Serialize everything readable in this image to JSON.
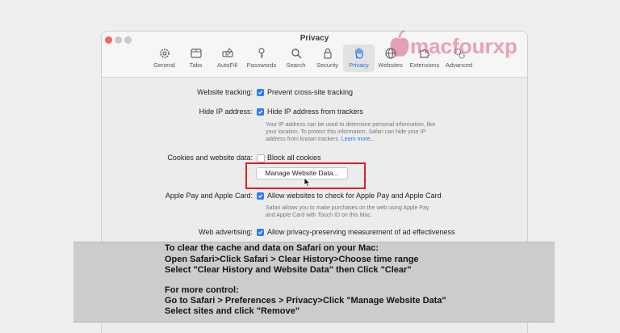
{
  "window": {
    "title": "Privacy"
  },
  "toolbar": {
    "items": [
      {
        "label": "General",
        "icon": "gear-icon"
      },
      {
        "label": "Tabs",
        "icon": "tabs-icon"
      },
      {
        "label": "AutoFill",
        "icon": "autofill-icon"
      },
      {
        "label": "Passwords",
        "icon": "key-icon"
      },
      {
        "label": "Search",
        "icon": "search-icon"
      },
      {
        "label": "Security",
        "icon": "lock-icon"
      },
      {
        "label": "Privacy",
        "icon": "hand-icon",
        "active": true
      },
      {
        "label": "Websites",
        "icon": "globe-icon"
      },
      {
        "label": "Extensions",
        "icon": "puzzle-icon"
      },
      {
        "label": "Advanced",
        "icon": "advanced-gears-icon"
      }
    ]
  },
  "settings": {
    "website_tracking": {
      "label": "Website tracking:",
      "option": "Prevent cross-site tracking",
      "checked": true
    },
    "hide_ip": {
      "label": "Hide IP address:",
      "option": "Hide IP address from trackers",
      "checked": true,
      "desc1": "Your IP address can be used to determine personal information, like",
      "desc2": "your location. To protect this information, Safari can hide your IP",
      "desc3": "address from known trackers.",
      "link": "Learn more..."
    },
    "cookies": {
      "label": "Cookies and website data:",
      "option": "Block all cookies",
      "checked": false,
      "button": "Manage Website Data..."
    },
    "apple_pay": {
      "label": "Apple Pay and Apple Card:",
      "option": "Allow websites to check for Apple Pay and Apple Card",
      "checked": true,
      "desc1": "Safari allows you to make purchases on the web using Apple Pay",
      "desc2": "and Apple Card with Touch ID on this Mac."
    },
    "web_advertising": {
      "label": "Web advertising:",
      "option": "Allow privacy-preserving measurement of ad effectiveness",
      "checked": true
    }
  },
  "watermark": {
    "text": "macfourxp"
  },
  "instructions": {
    "line1": "To clear the cache and data on Safari on your Mac:",
    "line2": "Open Safari>Click Safari > Clear History>Choose time range",
    "line3": "Select \"Clear History and Website Data\" then Click \"Clear\"",
    "line4": "For more control:",
    "line5": "Go to Safari > Preferences > Privacy>Click \"Manage Website Data\"",
    "line6": "Select sites and click \"Remove\""
  },
  "colors": {
    "accent": "#1e74e8",
    "checkbox": "#2d7cf6",
    "highlight": "#d8232a",
    "overlay": "#cccccc"
  }
}
